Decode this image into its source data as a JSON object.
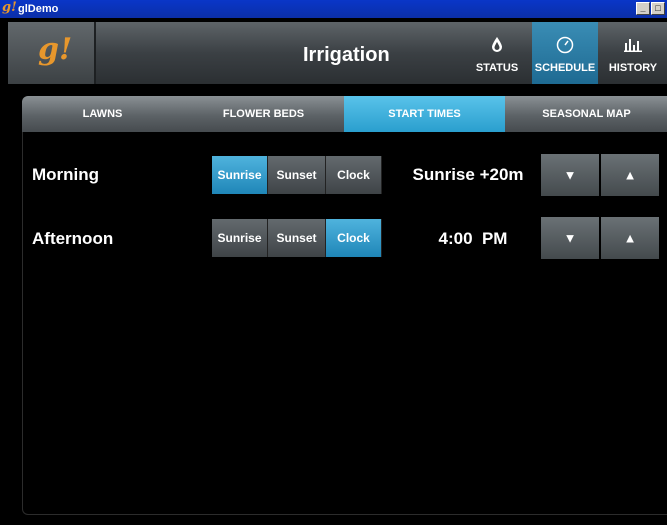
{
  "window": {
    "title": "glDemo",
    "logo": "g!"
  },
  "header": {
    "logo": "g!",
    "title": "Irrigation"
  },
  "nav": [
    {
      "label": "STATUS",
      "icon": "droplet-icon",
      "glyph": "💧"
    },
    {
      "label": "SCHEDULE",
      "icon": "clock-icon",
      "glyph": "◷"
    },
    {
      "label": "HISTORY",
      "icon": "bar-chart-icon",
      "glyph": "ılıl"
    }
  ],
  "tabs": [
    "LAWNS",
    "FLOWER BEDS",
    "START TIMES",
    "SEASONAL MAP"
  ],
  "active_tab": "START TIMES",
  "rows": [
    {
      "label": "Morning",
      "options": [
        "Sunrise",
        "Sunset",
        "Clock"
      ],
      "selected": "Sunrise",
      "value": "Sunrise +20m"
    },
    {
      "label": "Afternoon",
      "options": [
        "Sunrise",
        "Sunset",
        "Clock"
      ],
      "selected": "Clock",
      "value": "4:00  PM"
    }
  ],
  "colors": {
    "accent": "#2a9fce",
    "logo": "#e8972c",
    "titlebar": "#0a36c8"
  }
}
